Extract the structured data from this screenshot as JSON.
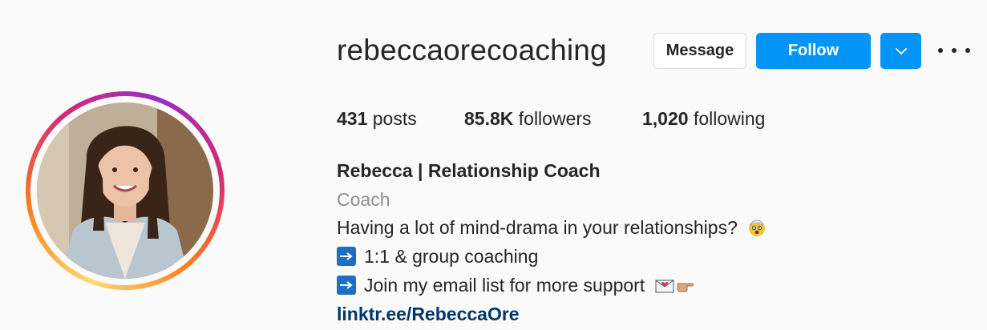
{
  "profile": {
    "username": "rebeccaorecoaching",
    "full_name": "Rebecca | Relationship Coach",
    "category": "Coach",
    "bio_line_1": "Having a lot of mind-drama in your relationships?",
    "bio_line_2": "1:1 & group coaching",
    "bio_line_3": "Join my email list for more support",
    "link": "linktr.ee/RebeccaOre"
  },
  "actions": {
    "message_label": "Message",
    "follow_label": "Follow"
  },
  "stats": {
    "posts_count": "431",
    "posts_label": "posts",
    "followers_count": "85.8K",
    "followers_label": "followers",
    "following_count": "1,020",
    "following_label": "following"
  },
  "icons": {
    "bio_line_1_emoji": "exploding-head-emoji",
    "bullet": "right-arrow-emoji",
    "bio_line_3_emojis": [
      "love-letter-emoji",
      "pointing-right-emoji"
    ],
    "dropdown": "chevron-down-icon",
    "more": "more-options-icon"
  },
  "colors": {
    "follow_button": "#0095f6",
    "link": "#00376b",
    "category": "#8e8e8e",
    "text": "#262626"
  }
}
